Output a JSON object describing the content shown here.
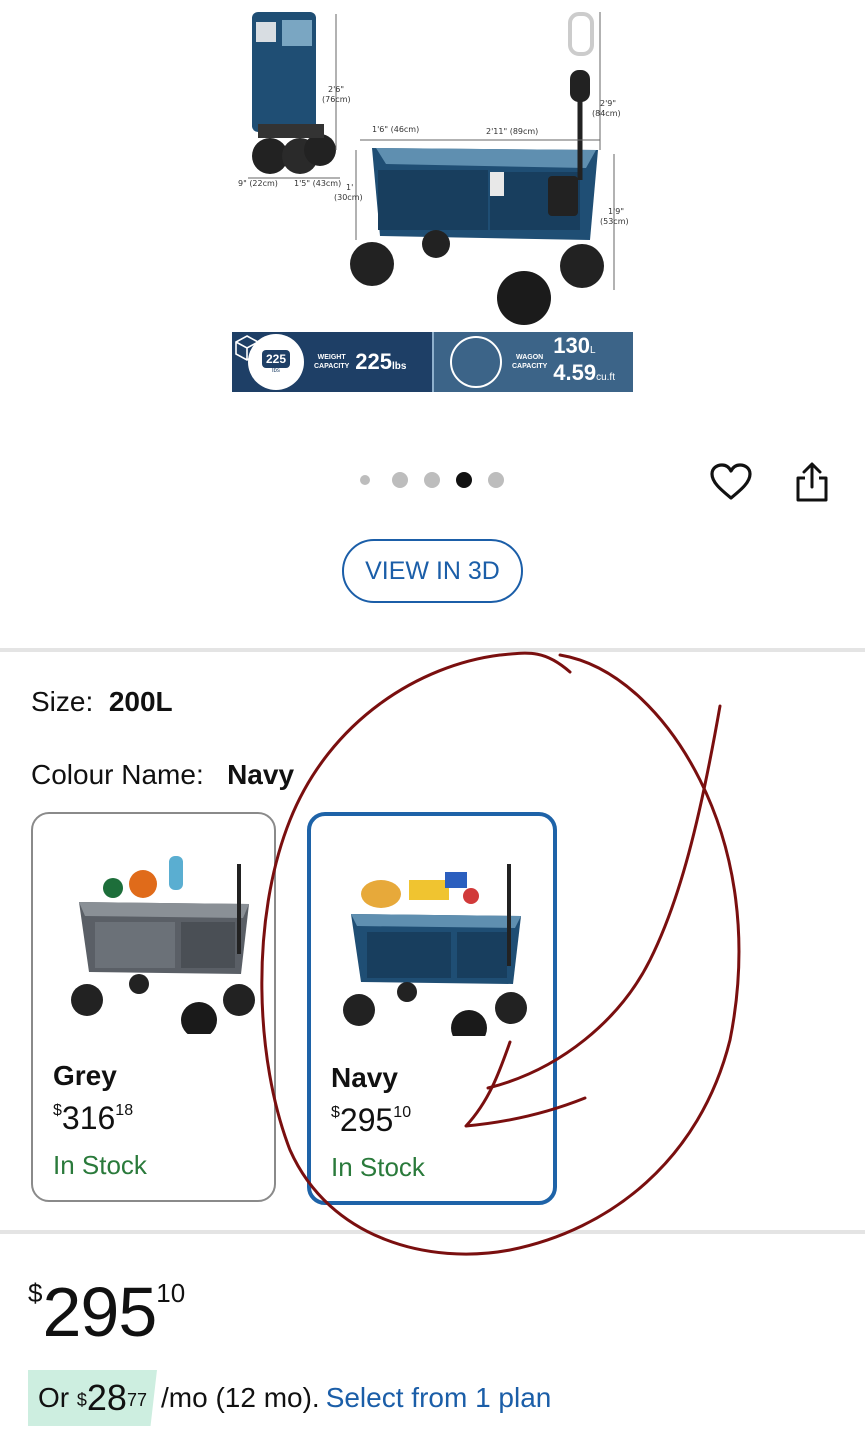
{
  "hero": {
    "dimensions": {
      "folded_height": "2'6\"",
      "folded_height_cm": "(76cm)",
      "folded_depth": "9\" (22cm)",
      "folded_width": "1'5\" (43cm)",
      "width_short": "1'6\" (46cm)",
      "length": "2'11\" (89cm)",
      "handle": "2'9\"",
      "handle_cm": "(84cm)",
      "bed_height": "1'",
      "bed_height_cm": "(30cm)",
      "total_height": "1'9\"",
      "total_height_cm": "(53cm)"
    },
    "weight_badge_value": "225",
    "weight_badge_unit": "lbs",
    "weight_label_1": "WEIGHT",
    "weight_label_2": "CAPACITY",
    "weight_value": "225",
    "weight_unit": "lbs",
    "wagon_label_1": "WAGON",
    "wagon_label_2": "CAPACITY",
    "wagon_capacity_l": "130",
    "wagon_capacity_l_unit": "L",
    "wagon_capacity_ft": "4.59",
    "wagon_capacity_ft_unit": "cu.ft"
  },
  "carousel": {
    "count": 5,
    "active_index": 3
  },
  "actions": {
    "favorite_icon": "heart-icon",
    "share_icon": "share-icon"
  },
  "view3d_label": "VIEW IN 3D",
  "size": {
    "label": "Size:",
    "value": "200L"
  },
  "colour": {
    "label": "Colour Name:",
    "value": "Navy"
  },
  "swatches": [
    {
      "name": "Grey",
      "currency": "$",
      "dollars": "316",
      "cents": "18",
      "stock": "In Stock",
      "selected": false
    },
    {
      "name": "Navy",
      "currency": "$",
      "dollars": "295",
      "cents": "10",
      "stock": "In Stock",
      "selected": true
    }
  ],
  "price": {
    "currency": "$",
    "dollars": "295",
    "cents": "10"
  },
  "plan": {
    "prefix": "Or",
    "currency": "$",
    "dollars": "28",
    "cents": "77",
    "suffix": "/mo (12 mo).",
    "link": "Select from 1 plan"
  },
  "colors": {
    "accent_blue": "#1b5ea8",
    "swatch_selected_border": "#1e63a8",
    "in_stock_green": "#2a7a3b",
    "plan_pill_bg": "#cdeee0",
    "annotation_ink": "#7a0f0f"
  }
}
